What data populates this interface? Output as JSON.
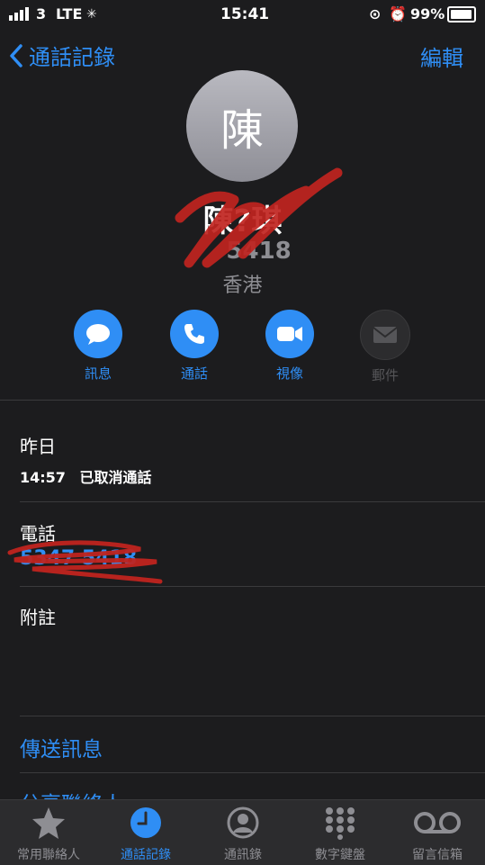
{
  "status": {
    "carrier": "3",
    "network": "LTE",
    "time": "15:41",
    "battery": "99%"
  },
  "nav": {
    "back_label": "通話記錄",
    "edit_label": "編輯"
  },
  "contact": {
    "avatar_initial": "陳",
    "name": "陳?琪",
    "number_partial": "5418",
    "region": "香港"
  },
  "actions": [
    {
      "label": "訊息",
      "icon": "message-icon",
      "enabled": true
    },
    {
      "label": "通話",
      "icon": "phone-icon",
      "enabled": true
    },
    {
      "label": "視像",
      "icon": "video-icon",
      "enabled": true
    },
    {
      "label": "郵件",
      "icon": "mail-icon",
      "enabled": false
    }
  ],
  "recents": {
    "day": "昨日",
    "time": "14:57",
    "event": "已取消通話"
  },
  "phone": {
    "label": "電話",
    "number": "5347 5418"
  },
  "notes": {
    "label": "附註"
  },
  "links": {
    "send_message": "傳送訊息",
    "share_contact": "分享聯絡人"
  },
  "tabs": [
    {
      "label": "常用聯絡人",
      "icon": "star-icon"
    },
    {
      "label": "通話記錄",
      "icon": "clock-icon",
      "active": true
    },
    {
      "label": "通訊錄",
      "icon": "person-icon"
    },
    {
      "label": "數字鍵盤",
      "icon": "keypad-icon"
    },
    {
      "label": "留言信箱",
      "icon": "voicemail-icon"
    }
  ],
  "colors": {
    "accent": "#2f8ef5",
    "background": "#1c1c1e",
    "scribble": "#c0241f"
  }
}
